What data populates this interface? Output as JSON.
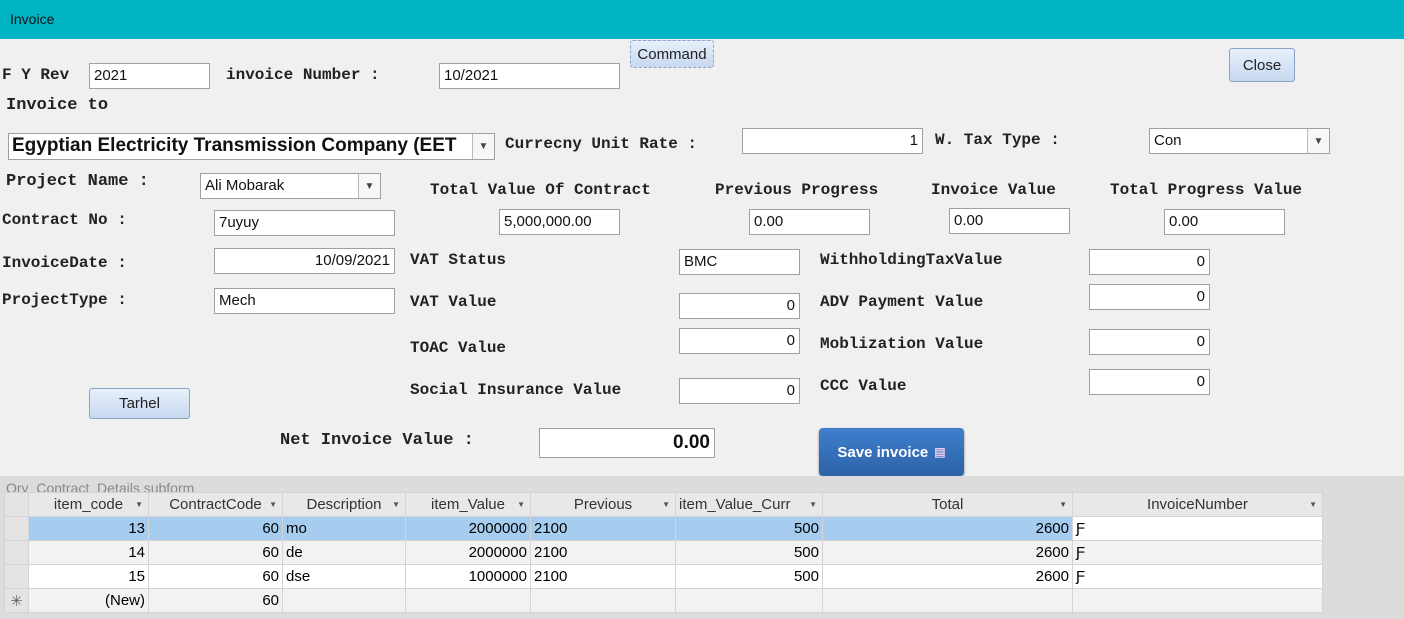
{
  "window": {
    "title": "Invoice"
  },
  "buttons": {
    "command": "Command",
    "close": "Close",
    "tarhel": "Tarhel",
    "save": "Save invoice"
  },
  "form": {
    "fy_rev_label": "F Y Rev",
    "fy_rev": "2021",
    "invoice_number_label": "invoice Number :",
    "invoice_number": "10/2021",
    "invoice_to_label": "Invoice to",
    "invoice_to": "Egyptian Electricity Transmission Company (EET",
    "currency_rate_label": "Currecny Unit Rate :",
    "currency_rate": "1",
    "wtax_type_label": "W. Tax Type :",
    "wtax_type": "Con",
    "project_name_label": "Project Name :",
    "project_name": "Ali Mobarak",
    "total_contract_label": "Total Value Of Contract",
    "total_contract": "5,000,000.00",
    "previous_progress_label": "Previous Progress",
    "previous_progress": "0.00",
    "invoice_value_label": "Invoice Value",
    "invoice_value": "0.00",
    "total_progress_label": "Total Progress Value",
    "total_progress": "0.00",
    "contract_no_label": "Contract No :",
    "contract_no": "7uyuy",
    "invoice_date_label": "InvoiceDate :",
    "invoice_date": "10/09/2021",
    "project_type_label": "ProjectType :",
    "project_type": "Mech",
    "vat_status_label": "VAT Status",
    "vat_status": "BMC",
    "vat_value_label": "VAT Value",
    "vat_value": "0",
    "toac_label": "TOAC Value",
    "toac": "0",
    "social_label": "Social Insurance Value",
    "social": "0",
    "wht_label": "WithholdingTaxValue",
    "wht": "0",
    "adv_label": "ADV Payment Value",
    "adv": "0",
    "mob_label": "Moblization Value",
    "mob": "0",
    "ccc_label": "CCC Value",
    "ccc": "0",
    "net_label": "Net Invoice Value :",
    "net": "0.00"
  },
  "subform": {
    "caption": "Qry_Contract_Details subform",
    "columns": [
      "item_code",
      "ContractCode",
      "Description",
      "item_Value",
      "Previous",
      "item_Value_Curr",
      "Total",
      "InvoiceNumber"
    ],
    "rows": [
      [
        "13",
        "60",
        "mo",
        "2000000",
        "2100",
        "500",
        "2600",
        "Ƒ"
      ],
      [
        "14",
        "60",
        "de",
        "2000000",
        "2100",
        "500",
        "2600",
        "Ƒ"
      ],
      [
        "15",
        "60",
        "dse",
        "1000000",
        "2100",
        "500",
        "2600",
        "Ƒ"
      ]
    ],
    "new_row": {
      "marker": "✳",
      "item_code": "(New)",
      "contract_code": "60"
    }
  }
}
